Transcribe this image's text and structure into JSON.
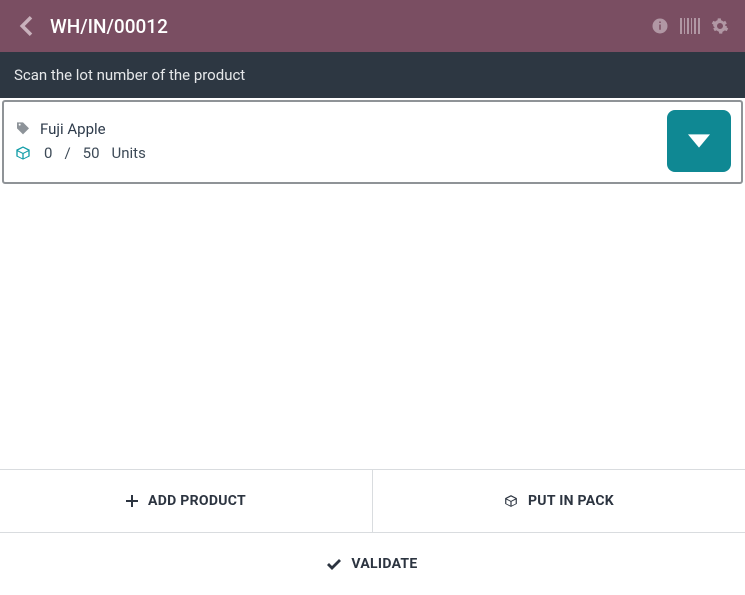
{
  "header": {
    "title": "WH/IN/00012"
  },
  "scan_prompt": "Scan the lot number of the product",
  "product": {
    "name": "Fuji Apple",
    "qty_done": "0",
    "qty_sep": "/",
    "qty_total": "50",
    "uom": "Units"
  },
  "actions": {
    "add_product": "ADD PRODUCT",
    "put_in_pack": "PUT IN PACK",
    "validate": "VALIDATE"
  }
}
